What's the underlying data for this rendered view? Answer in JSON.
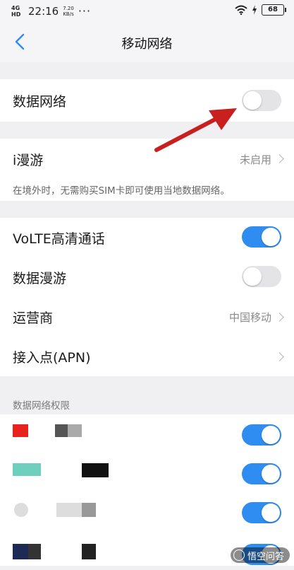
{
  "status_bar": {
    "network": "4G HD",
    "time": "22:16",
    "speed_value": "7.20",
    "speed_unit": "KB/s",
    "more": "···",
    "battery": "68"
  },
  "header": {
    "title": "移动网络"
  },
  "settings": {
    "data_network": {
      "label": "数据网络",
      "enabled": false
    },
    "i_roaming": {
      "label": "i漫游",
      "value": "未启用",
      "hint": "在境外时，无需购买SIM卡即可使用当地数据网络。"
    },
    "volte": {
      "label": "VoLTE高清通话",
      "enabled": true
    },
    "data_roaming": {
      "label": "数据漫游",
      "enabled": false
    },
    "carrier": {
      "label": "运营商",
      "value": "中国移动"
    },
    "apn": {
      "label": "接入点(APN)"
    }
  },
  "permissions": {
    "header": "数据网络权限",
    "apps": [
      {
        "enabled": true
      },
      {
        "enabled": true
      },
      {
        "enabled": true
      },
      {
        "enabled": true
      }
    ]
  },
  "watermark": "悟空问答",
  "colors": {
    "accent": "#2f8cf0",
    "annotation_arrow": "#c8201e"
  }
}
